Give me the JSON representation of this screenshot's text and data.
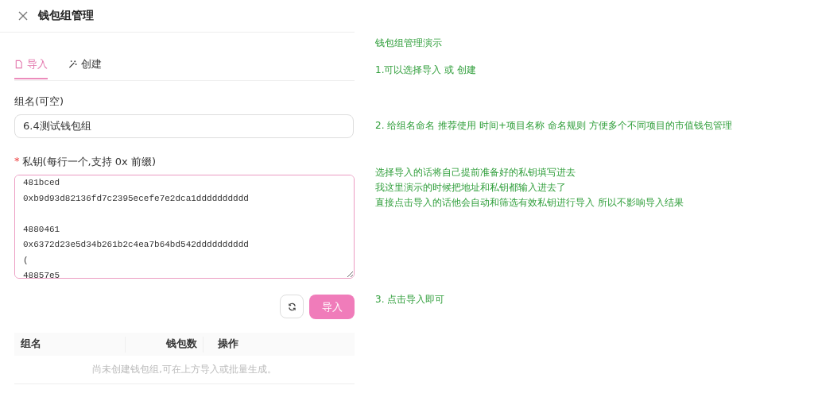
{
  "window": {
    "title": "钱包组管理"
  },
  "tabs": [
    {
      "label": "导入",
      "selected": true,
      "kind": "import"
    },
    {
      "label": "创建",
      "selected": false,
      "kind": "create"
    }
  ],
  "group_name": {
    "label": "组名(可空)",
    "value": "6.4测试钱包组"
  },
  "private_keys": {
    "required_mark": "*",
    "label": "私钥(每行一个,支持 0x 前缀)",
    "value": "481bced\n0xb9d93d82136fd7c2395ecefe7e2dca1dddddddddd\n\n4880461\n0x6372d23e5d34b261b2c4ea7b64bd542dddddddddd\n(\n48857e5"
  },
  "buttons": {
    "import": "导入"
  },
  "table": {
    "columns": [
      "组名",
      "钱包数",
      "操作"
    ],
    "empty_text": "尚未创建钱包组,可在上方导入或批量生成。"
  },
  "notes": [
    "钱包组管理演示",
    "1.可以选择导入 或 创建",
    "2. 给组名命名 推荐使用 时间+项目名称 命名规则 方便多个不同项目的市值钱包管理",
    "选择导入的话将自己提前准备好的私钥填写进去",
    "我这里演示的时候把地址和私钥都输入进去了",
    "直接点击导入的话他会自动和筛选有效私钥进行导入  所以不影响导入结果",
    "3. 点击导入即可"
  ]
}
